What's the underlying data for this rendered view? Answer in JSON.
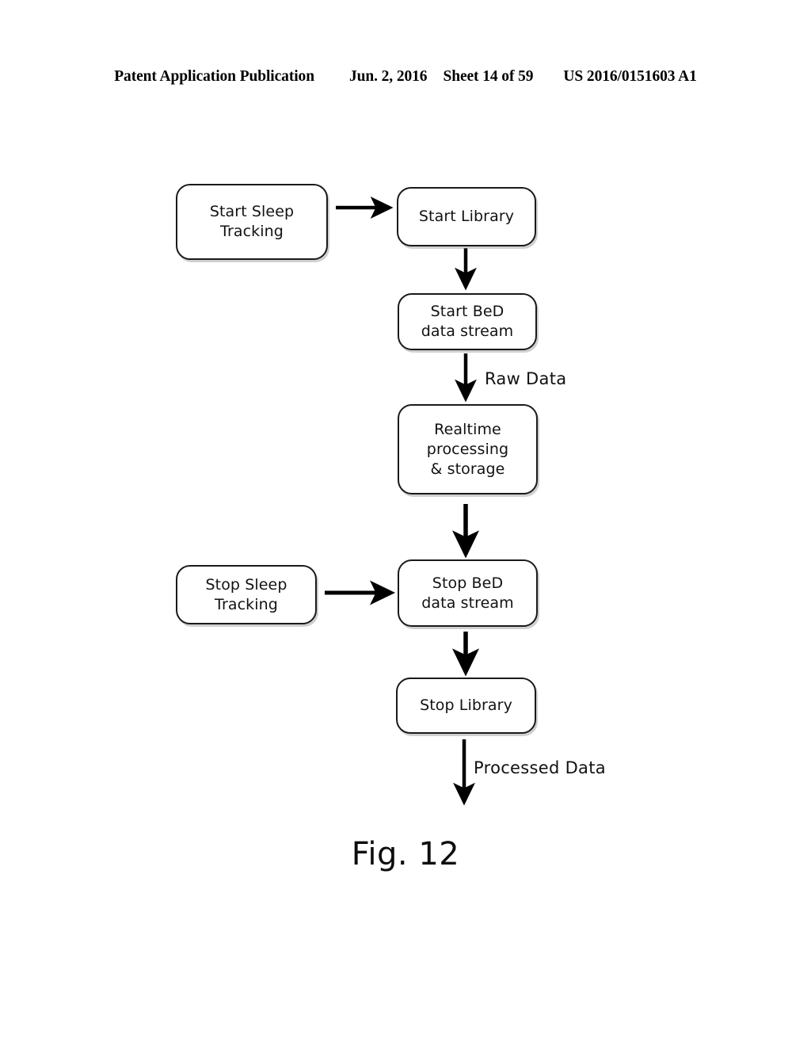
{
  "header": {
    "publication": "Patent Application Publication",
    "date": "Jun. 2, 2016",
    "sheet": "Sheet 14 of 59",
    "number": "US 2016/0151603 A1"
  },
  "figure": {
    "caption": "Fig. 12",
    "type": "flowchart",
    "nodes": [
      {
        "id": "start-sleep-tracking",
        "label": "Start Sleep\nTracking"
      },
      {
        "id": "start-library",
        "label": "Start Library"
      },
      {
        "id": "start-bed-stream",
        "label": "Start BeD\ndata stream"
      },
      {
        "id": "realtime-processing",
        "label": "Realtime\nprocessing\n& storage"
      },
      {
        "id": "stop-sleep-tracking",
        "label": "Stop Sleep\nTracking"
      },
      {
        "id": "stop-bed-stream",
        "label": "Stop BeD\ndata stream"
      },
      {
        "id": "stop-library",
        "label": "Stop Library"
      }
    ],
    "edges": [
      {
        "from": "start-sleep-tracking",
        "to": "start-library",
        "label": "",
        "direction": "right"
      },
      {
        "from": "start-library",
        "to": "start-bed-stream",
        "label": "",
        "direction": "down"
      },
      {
        "from": "start-bed-stream",
        "to": "realtime-processing",
        "label": "Raw Data",
        "direction": "down"
      },
      {
        "from": "realtime-processing",
        "to": "stop-bed-stream",
        "label": "",
        "direction": "down"
      },
      {
        "from": "stop-sleep-tracking",
        "to": "stop-bed-stream",
        "label": "",
        "direction": "right"
      },
      {
        "from": "stop-bed-stream",
        "to": "stop-library",
        "label": "",
        "direction": "down"
      },
      {
        "from": "stop-library",
        "to": "",
        "label": "Processed Data",
        "direction": "down"
      }
    ],
    "labels": {
      "raw_data": "Raw Data",
      "processed_data": "Processed Data"
    }
  },
  "colors": {
    "ink": "#000000",
    "page": "#ffffff",
    "node_border": "#1a1a1a",
    "node_shadow": "#969696"
  }
}
